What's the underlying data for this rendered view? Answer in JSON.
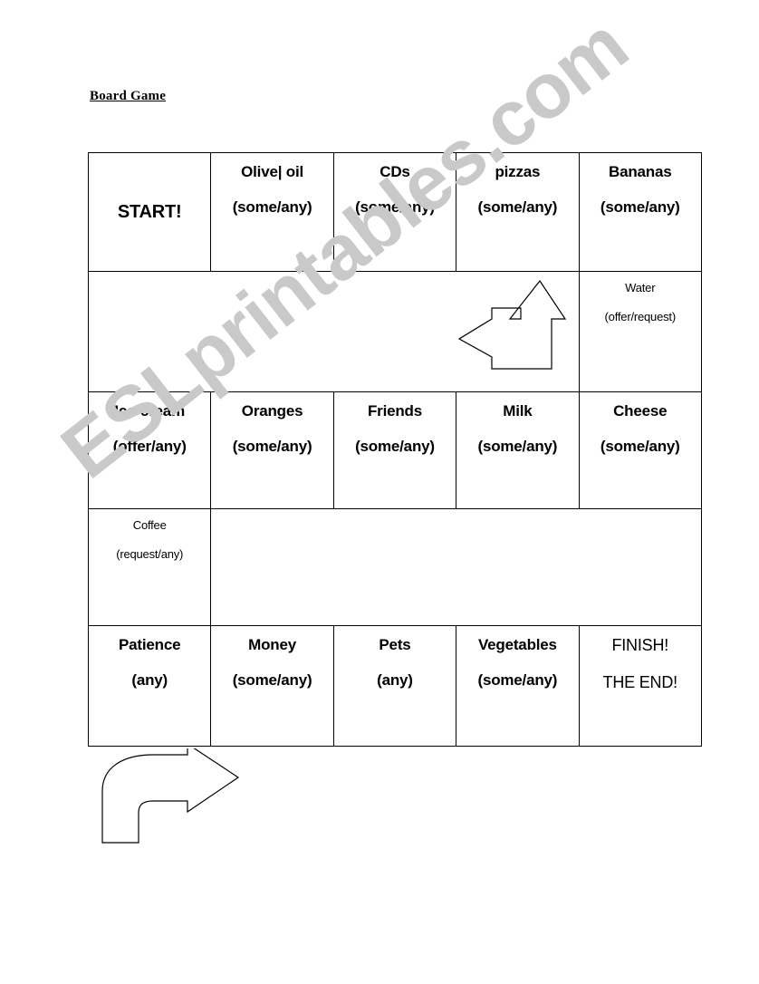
{
  "document": {
    "title": "Board Game",
    "watermark": "ESLprintables.com",
    "watermark_color": "#c9c9c9"
  },
  "board": {
    "rows": [
      {
        "type": "cells",
        "cells": [
          {
            "word": "START!",
            "hint": "",
            "style": "start"
          },
          {
            "word": "Olive| oil",
            "hint": "(some/any)",
            "style": "normal"
          },
          {
            "word": "CDs",
            "hint": "(some/any)",
            "style": "normal"
          },
          {
            "word": "pizzas",
            "hint": "(some/any)",
            "style": "normal"
          },
          {
            "word": "Bananas",
            "hint": "(some/any)",
            "style": "normal"
          }
        ]
      },
      {
        "type": "gap",
        "cells": [
          {
            "word": "",
            "hint": "",
            "style": "empty",
            "colspan": 4
          },
          {
            "word": "Water",
            "hint": "(offer/request)",
            "style": "small"
          }
        ]
      },
      {
        "type": "cells",
        "cells": [
          {
            "word": "Ice-cream",
            "hint": "(offer/any)",
            "style": "normal"
          },
          {
            "word": "Oranges",
            "hint": "(some/any)",
            "style": "normal"
          },
          {
            "word": "Friends",
            "hint": "(some/any)",
            "style": "normal"
          },
          {
            "word": "Milk",
            "hint": "(some/any)",
            "style": "normal"
          },
          {
            "word": "Cheese",
            "hint": "(some/any)",
            "style": "normal"
          }
        ]
      },
      {
        "type": "gap",
        "cells": [
          {
            "word": "Coffee",
            "hint": "(request/any)",
            "style": "small"
          },
          {
            "word": "",
            "hint": "",
            "style": "empty",
            "colspan": 4
          }
        ]
      },
      {
        "type": "cells",
        "cells": [
          {
            "word": "Patience",
            "hint": "(any)",
            "style": "normal"
          },
          {
            "word": "Money",
            "hint": "(some/any)",
            "style": "normal"
          },
          {
            "word": "Pets",
            "hint": "(any)",
            "style": "normal"
          },
          {
            "word": "Vegetables",
            "hint": "(some/any)",
            "style": "normal"
          },
          {
            "word": "FINISH!",
            "hint": "THE END!",
            "style": "light"
          }
        ]
      }
    ]
  },
  "arrows": [
    {
      "name": "up-then-left-arrow",
      "direction": "up-left"
    },
    {
      "name": "bend-right-arrow",
      "direction": "right"
    }
  ]
}
